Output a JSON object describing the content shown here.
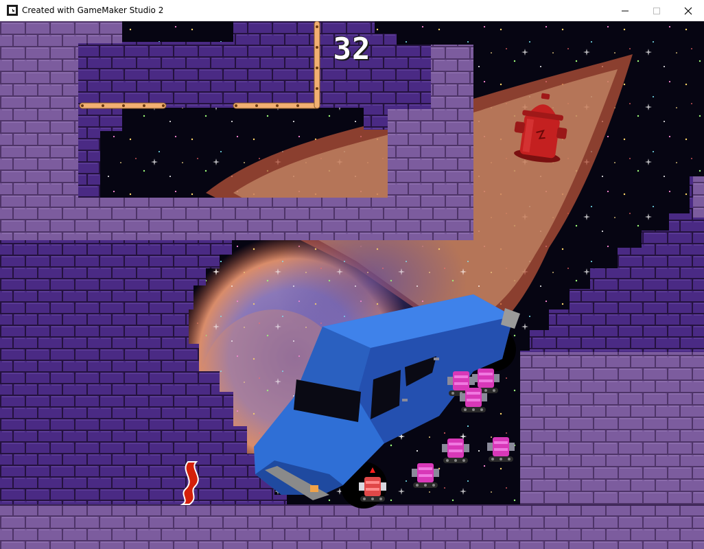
{
  "window": {
    "title": "Created with GameMaker Studio 2",
    "controls": {
      "minimize": "minimize",
      "maximize": "maximize",
      "close": "close"
    }
  },
  "hud": {
    "score": "32"
  },
  "entities": {
    "car": {
      "color": "#2f6fd6"
    },
    "fire_hydrant": {
      "color": "#c42020"
    },
    "tank_robots": {
      "count": 8,
      "color": "#d838b8"
    },
    "speed_boost_pickup": {
      "color": "#d4200a"
    }
  },
  "theme": {
    "brick_light": "#7a5a9c",
    "brick_dark": "#4c2c86",
    "space": "#050510",
    "nebula_outer": "#b8533a",
    "nebula_inner": "#6a5aa6"
  }
}
